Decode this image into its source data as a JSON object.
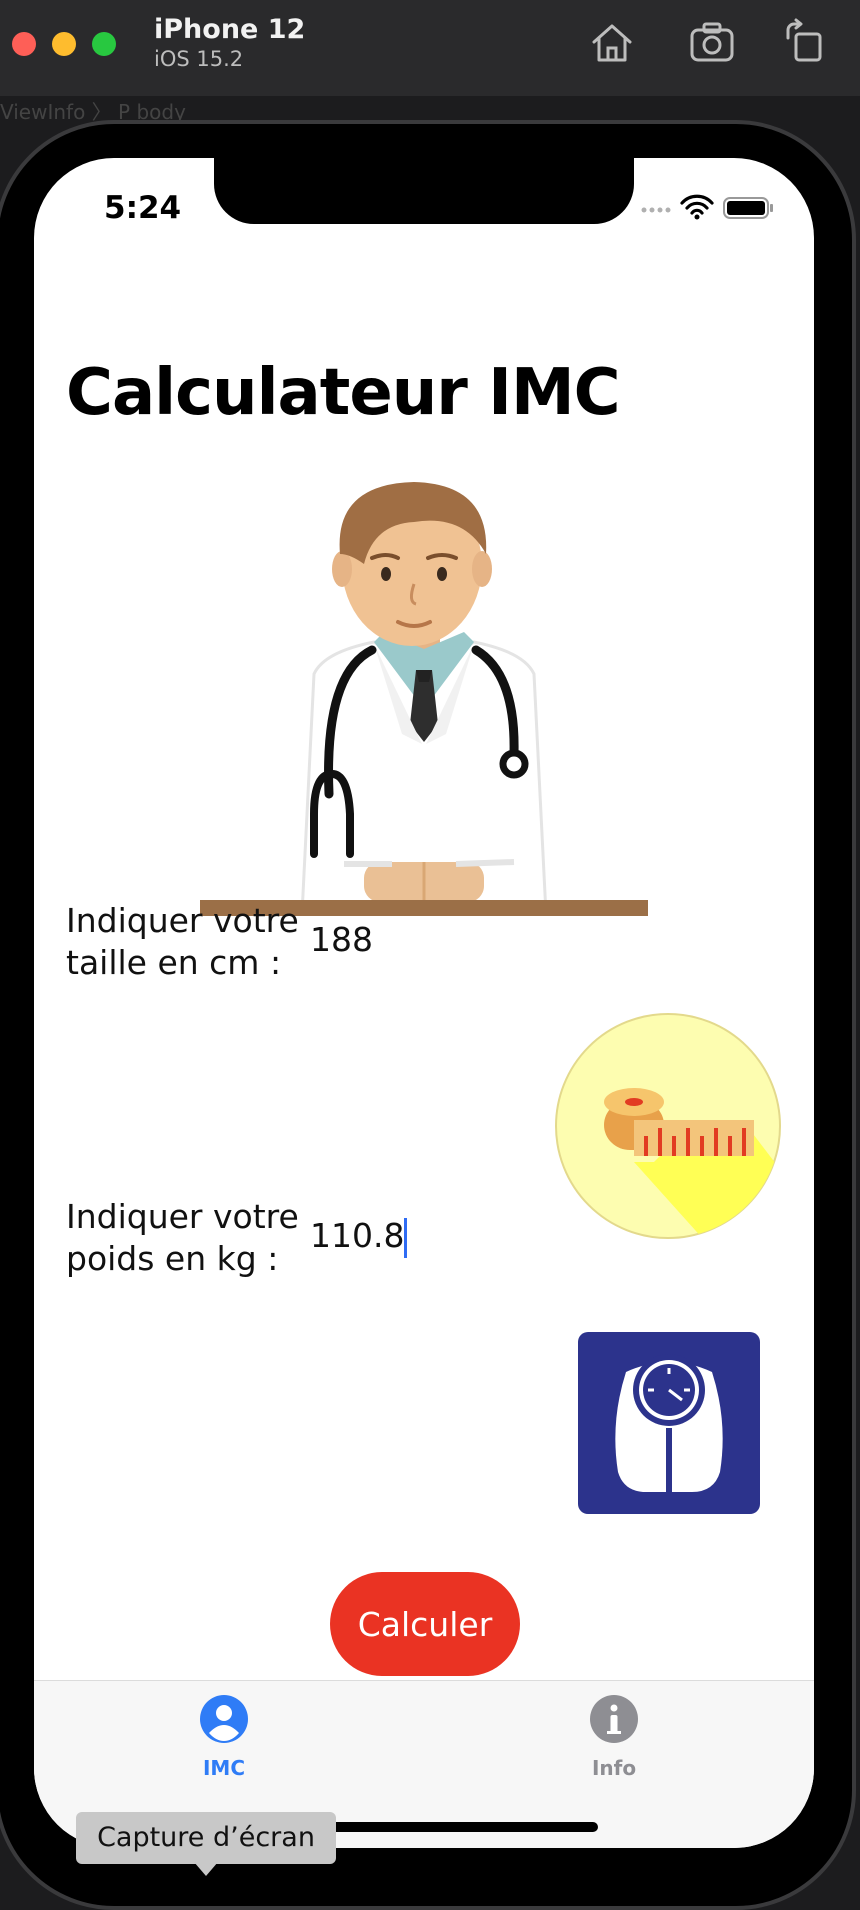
{
  "simulator": {
    "device_name": "iPhone 12",
    "os_version": "iOS 15.2",
    "buttons": [
      "home-icon",
      "screenshot-icon",
      "rotate-icon"
    ],
    "breadcrumb": "ViewInfo 〉 P body"
  },
  "status_bar": {
    "time": "5:24"
  },
  "app": {
    "title": "Calculateur IMC",
    "height_field": {
      "label": "Indiquer votre taille en cm :",
      "value": "188"
    },
    "weight_field": {
      "label": "Indiquer votre poids en kg :",
      "value": "110.8"
    },
    "calculate_label": "Calculer",
    "accent_color": "#ea3323"
  },
  "tabbar": {
    "tabs": [
      {
        "label": "IMC",
        "icon": "person-icon",
        "active": true,
        "color": "#2f7cf6"
      },
      {
        "label": "Info",
        "icon": "info-icon",
        "active": false,
        "color": "#8e8e93"
      }
    ]
  },
  "tooltip": {
    "text": "Capture d’écran"
  }
}
